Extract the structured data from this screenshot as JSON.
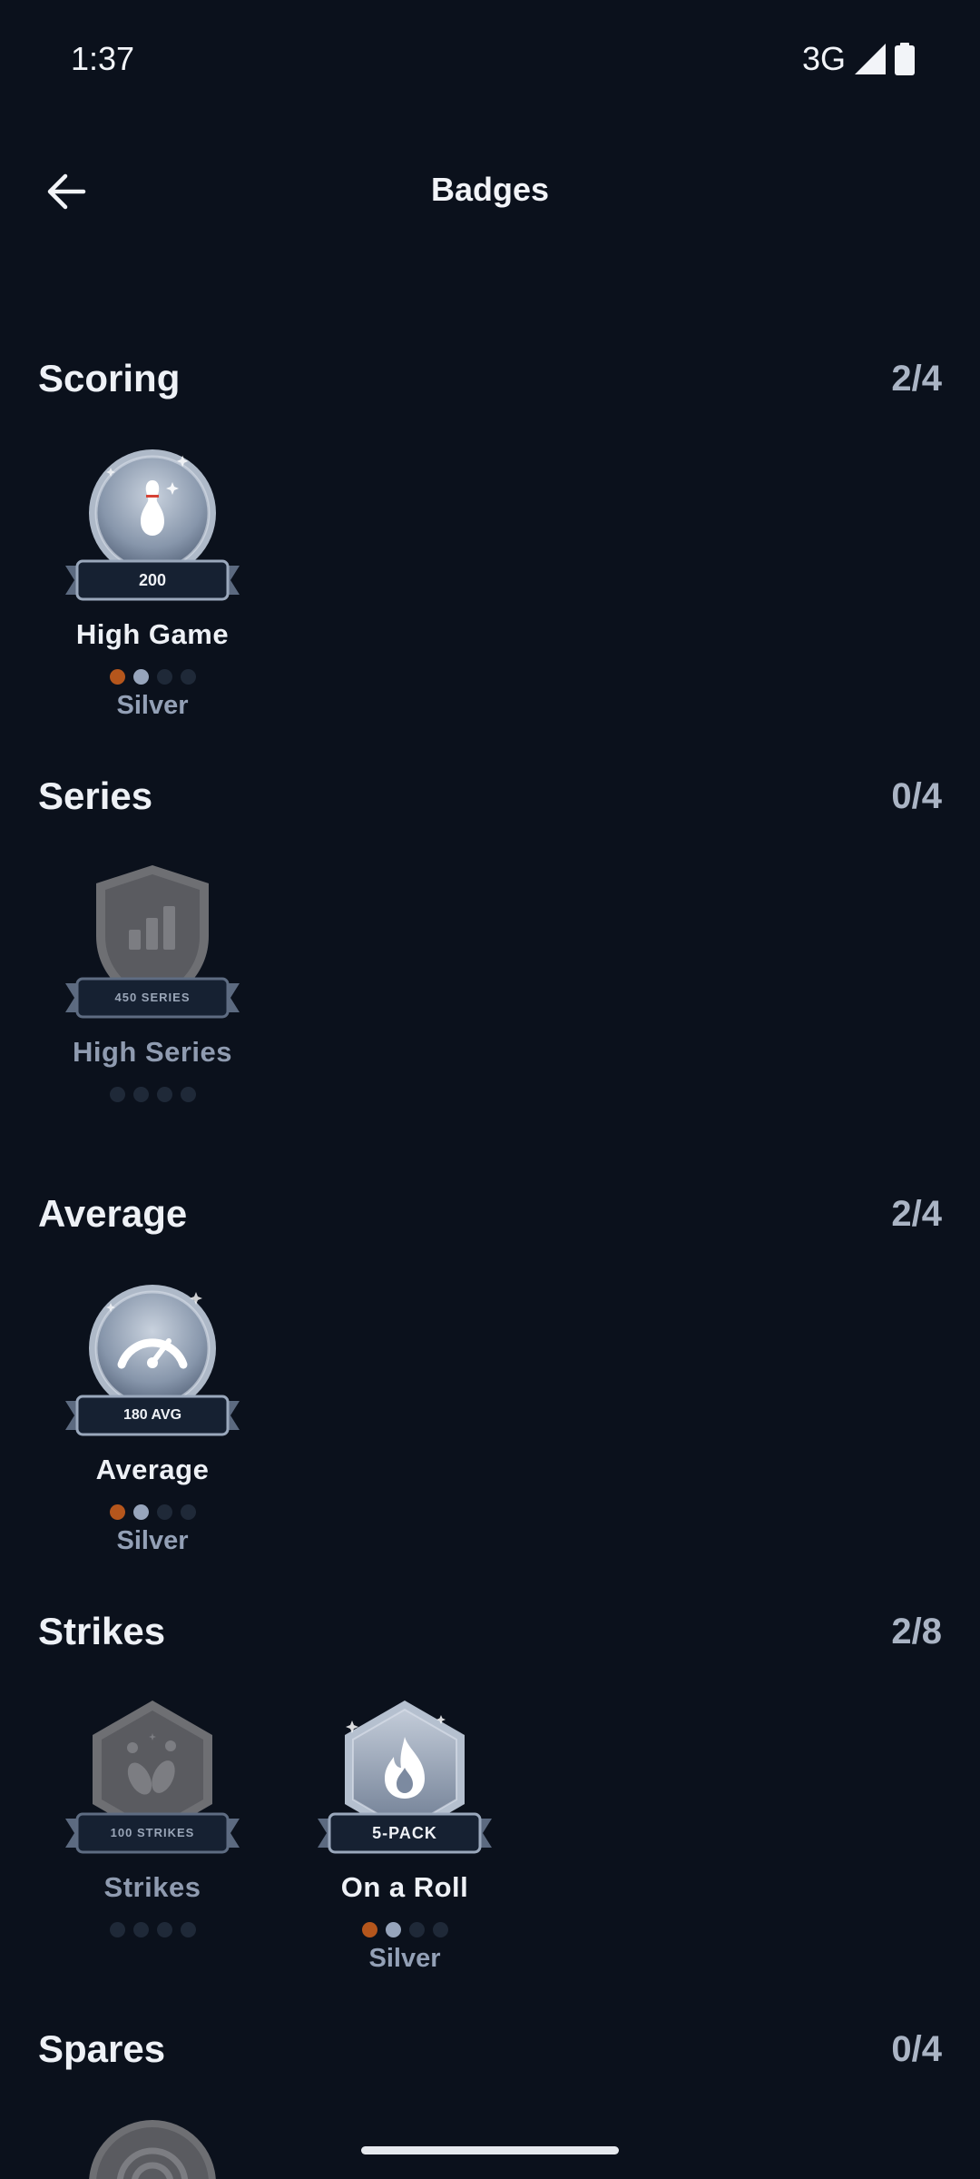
{
  "status_bar": {
    "time": "1:37",
    "network": "3G"
  },
  "app_bar": {
    "title": "Badges"
  },
  "sections": [
    {
      "title": "Scoring",
      "count": "2/4",
      "badges": [
        {
          "name": "High Game",
          "ribbon": "200",
          "tier": "Silver",
          "icon": "bowling-pin-icon",
          "shape": "circle",
          "earned": true,
          "dots": [
            "bronze",
            "silver",
            "empty",
            "empty"
          ]
        }
      ]
    },
    {
      "title": "Series",
      "count": "0/4",
      "badges": [
        {
          "name": "High Series",
          "ribbon": "450 SERIES",
          "tier": "",
          "icon": "bar-chart-icon",
          "shape": "shield",
          "earned": false,
          "dots": [
            "empty",
            "empty",
            "empty",
            "empty"
          ]
        }
      ]
    },
    {
      "title": "Average",
      "count": "2/4",
      "badges": [
        {
          "name": "Average",
          "ribbon": "180 AVG",
          "tier": "Silver",
          "icon": "speedometer-icon",
          "shape": "circle",
          "earned": true,
          "dots": [
            "bronze",
            "silver",
            "empty",
            "empty"
          ]
        }
      ]
    },
    {
      "title": "Strikes",
      "count": "2/8",
      "badges": [
        {
          "name": "Strikes",
          "ribbon": "100 STRIKES",
          "tier": "",
          "icon": "falling-pins-icon",
          "shape": "hexagon",
          "earned": false,
          "dots": [
            "empty",
            "empty",
            "empty",
            "empty"
          ]
        },
        {
          "name": "On a Roll",
          "ribbon": "5-PACK",
          "tier": "Silver",
          "icon": "flame-icon",
          "shape": "hexagon",
          "earned": true,
          "dots": [
            "bronze",
            "silver",
            "empty",
            "empty"
          ]
        }
      ]
    },
    {
      "title": "Spares",
      "count": "0/4",
      "badges": []
    }
  ],
  "colors": {
    "background": "#0b111c",
    "bronze": "#b5561c",
    "silver": "#97a5bc",
    "dot_empty": "#1f2938"
  }
}
